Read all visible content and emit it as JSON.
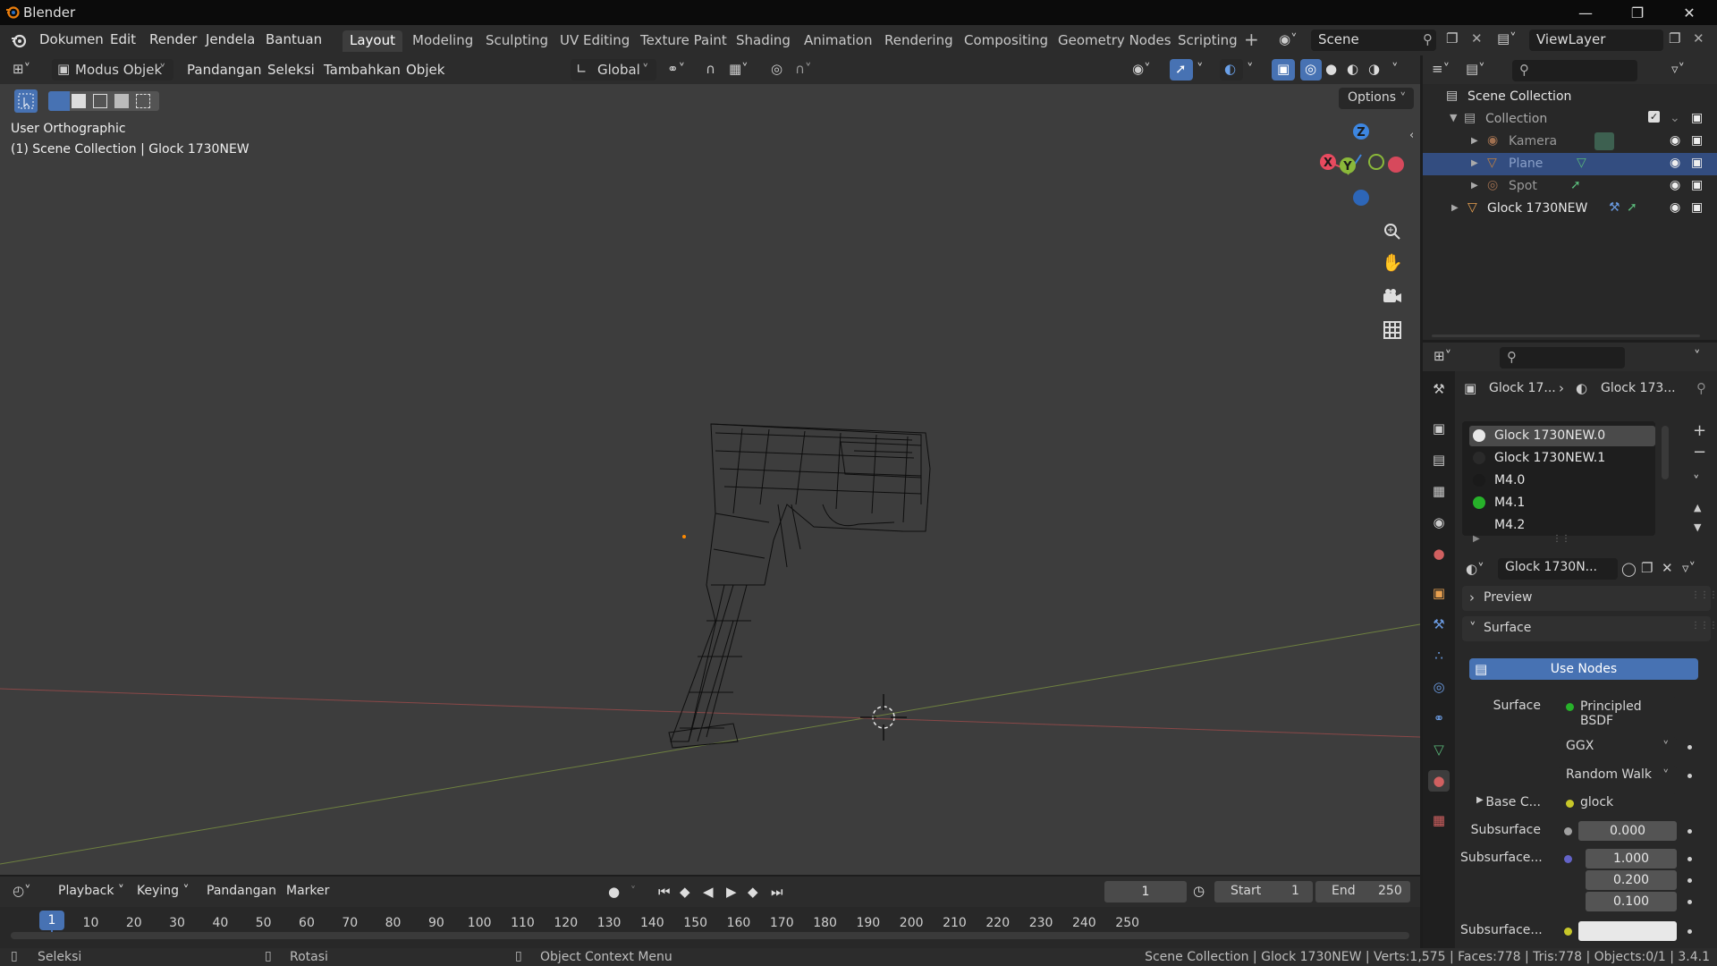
{
  "titlebar": {
    "title": "Blender"
  },
  "menubar": {
    "items": [
      "Dokumen",
      "Edit",
      "Render",
      "Jendela",
      "Bantuan"
    ]
  },
  "workspaces": {
    "active": "Layout",
    "tabs": [
      "Layout",
      "Modeling",
      "Sculpting",
      "UV Editing",
      "Texture Paint",
      "Shading",
      "Animation",
      "Rendering",
      "Compositing",
      "Geometry Nodes",
      "Scripting"
    ]
  },
  "scene": {
    "name": "Scene",
    "view_layer": "ViewLayer"
  },
  "viewport_header": {
    "mode": "Modus Objek",
    "menus": [
      "Pandangan",
      "Seleksi",
      "Tambahkan",
      "Objek"
    ],
    "transform_orientation": "Global",
    "options_label": "Options"
  },
  "viewport": {
    "view_name": "User Orthographic",
    "object_info": "(1) Scene Collection | Glock 1730NEW",
    "gizmo_axes": {
      "x": "X",
      "y": "Y",
      "z": "Z"
    }
  },
  "outliner": {
    "root": "Scene Collection",
    "collection": "Collection",
    "items": [
      {
        "name": "Kamera",
        "icon": "camera-data-icon"
      },
      {
        "name": "Plane",
        "icon": "mesh-data-icon",
        "selected": true
      },
      {
        "name": "Spot",
        "icon": "light-data-icon"
      }
    ],
    "object": "Glock 1730NEW"
  },
  "properties": {
    "breadcrumb_object": "Glock 17...",
    "breadcrumb_material": "Glock 173...",
    "material_slots": [
      {
        "name": "Glock 1730NEW.0",
        "color": "#6a6a6a",
        "active": true
      },
      {
        "name": "Glock 1730NEW.1",
        "color": "#e8e8e8"
      },
      {
        "name": "M4.0",
        "color": "#2a2a2a"
      },
      {
        "name": "M4.1",
        "color": "#1a1a1a"
      },
      {
        "name": "M4.2",
        "color": "#27b12a"
      }
    ],
    "material_name": "Glock 1730N...",
    "panel_preview": "Preview",
    "panel_surface": "Surface",
    "use_nodes": "Use Nodes",
    "surface_label": "Surface",
    "surface_shader": "Principled BSDF",
    "distribution": "GGX",
    "subsurface_method": "Random Walk",
    "base_color_label": "Base C...",
    "base_color_value": "glock",
    "subsurface_label": "Subsurface",
    "subsurface_value": "0.000",
    "subsurface_radius_label": "Subsurface...",
    "subsurface_radius": [
      "1.000",
      "0.200",
      "0.100"
    ],
    "subsurface_color_label": "Subsurface..."
  },
  "timeline": {
    "menus": [
      "Playback",
      "Keying",
      "Pandangan",
      "Marker"
    ],
    "current_frame": "1",
    "start_label": "Start",
    "start": "1",
    "end_label": "End",
    "end": "250",
    "ticks": [
      "10",
      "20",
      "30",
      "40",
      "50",
      "60",
      "70",
      "80",
      "90",
      "100",
      "110",
      "120",
      "130",
      "140",
      "150",
      "160",
      "170",
      "180",
      "190",
      "200",
      "210",
      "220",
      "230",
      "240",
      "250"
    ]
  },
  "statusbar": {
    "select": "Seleksi",
    "rotate": "Rotasi",
    "context_menu": "Object Context Menu",
    "stats": "Scene Collection | Glock 1730NEW | Verts:1,575 | Faces:778 | Tris:778 | Objects:0/1 | 3.4.1"
  },
  "colors": {
    "accent_blue": "#4772b3",
    "x_axis": "#e84a5f",
    "y_axis": "#8ab83a",
    "z_axis": "#3d86e0",
    "selected_row": "#334d80"
  }
}
